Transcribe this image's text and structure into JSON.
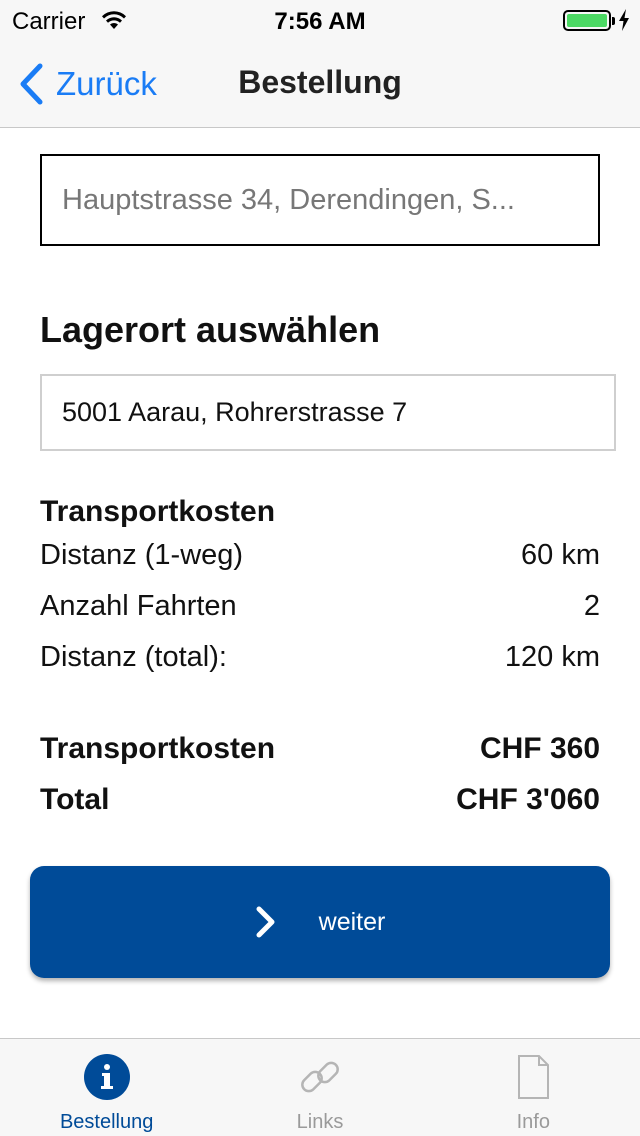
{
  "status_bar": {
    "carrier": "Carrier",
    "time": "7:56 AM",
    "battery_level": 1.0
  },
  "nav": {
    "back_label": "Zurück",
    "title": "Bestellung"
  },
  "address": {
    "placeholder": "Hauptstrasse 34, Derendingen, S..."
  },
  "storage": {
    "section_title": "Lagerort auswählen",
    "selected": "5001 Aarau, Rohrerstrasse 7"
  },
  "costs": {
    "heading": "Transportkosten",
    "rows": [
      {
        "label": "Distanz (1-weg)",
        "value": "60 km"
      },
      {
        "label": "Anzahl Fahrten",
        "value": "2"
      },
      {
        "label": "Distanz (total):",
        "value": "120 km"
      }
    ],
    "summary": [
      {
        "label": "Transportkosten",
        "value": "CHF 360"
      },
      {
        "label": "Total",
        "value": "CHF 3'060"
      }
    ]
  },
  "action": {
    "continue_label": "weiter"
  },
  "tabs": [
    {
      "label": "Bestellung",
      "icon": "info-icon",
      "active": true
    },
    {
      "label": "Links",
      "icon": "link-icon",
      "active": false
    },
    {
      "label": "Info",
      "icon": "document-icon",
      "active": false
    }
  ],
  "colors": {
    "accent": "#1a7cf5",
    "primary": "#004b98",
    "battery": "#4cd964"
  }
}
